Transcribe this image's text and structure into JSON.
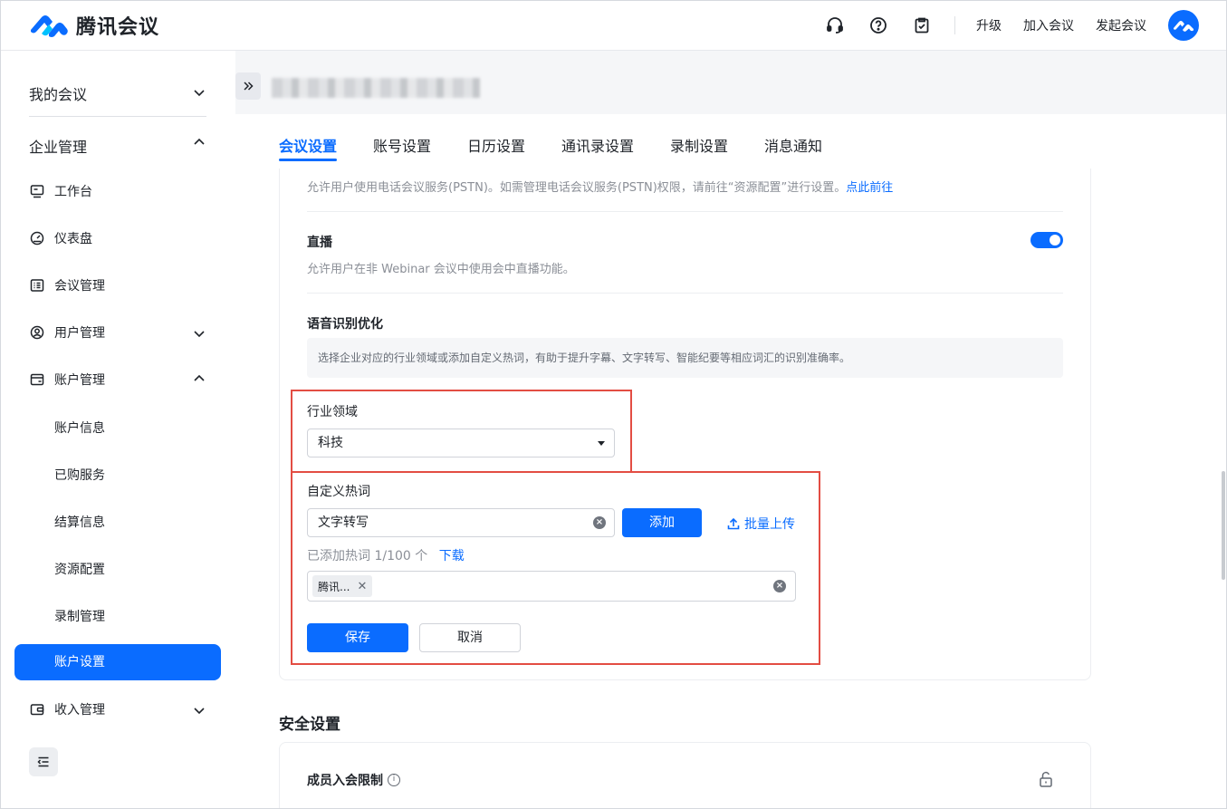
{
  "app": {
    "name": "腾讯会议"
  },
  "header": {
    "upgrade": "升级",
    "join": "加入会议",
    "start": "发起会议"
  },
  "sidebar": {
    "my_meetings": "我的会议",
    "enterprise": "企业管理",
    "workbench": "工作台",
    "dashboard": "仪表盘",
    "meeting_mgmt": "会议管理",
    "user_mgmt": "用户管理",
    "account_mgmt": "账户管理",
    "account_info": "账户信息",
    "purchased": "已购服务",
    "billing": "结算信息",
    "resources": "资源配置",
    "recording": "录制管理",
    "account_settings": "账户设置",
    "income": "收入管理"
  },
  "tabs": [
    "会议设置",
    "账号设置",
    "日历设置",
    "通讯录设置",
    "录制设置",
    "消息通知"
  ],
  "settings": {
    "pstn_desc": "允许用户使用电话会议服务(PSTN)。如需管理电话会议服务(PSTN)权限，请前往“资源配置”进行设置。",
    "pstn_link": "点此前往",
    "live_title": "直播",
    "live_desc": "允许用户在非 Webinar 会议中使用会中直播功能。",
    "speech_title": "语音识别优化",
    "speech_hint": "选择企业对应的行业领域或添加自定义热词，有助于提升字幕、文字转写、智能纪要等相应词汇的识别准确率。",
    "industry_label": "行业领域",
    "industry_value": "科技",
    "hotword_label": "自定义热词",
    "hotword_input": "文字转写",
    "add_btn": "添加",
    "batch_upload": "批量上传",
    "added_count": "已添加热词 1/100 个",
    "download": "下载",
    "tag": "腾讯...",
    "save": "保存",
    "cancel": "取消"
  },
  "security": {
    "title": "安全设置",
    "member_limit": "成员入会限制"
  },
  "colors": {
    "accent": "#0a6cff",
    "highlight": "#e34d43"
  }
}
